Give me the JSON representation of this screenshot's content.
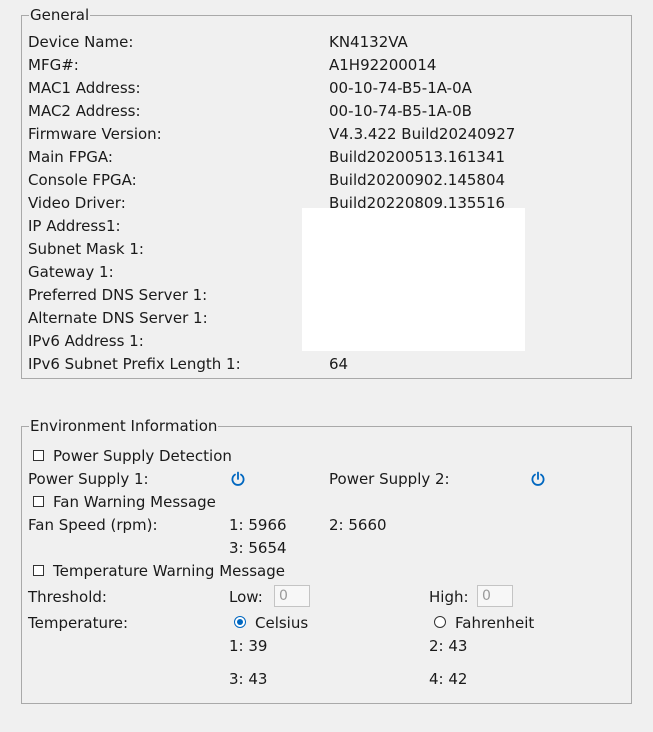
{
  "general": {
    "legend": "General",
    "rows": [
      {
        "label": "Device Name:",
        "value": "KN4132VA"
      },
      {
        "label": "MFG#:",
        "value": "A1H92200014"
      },
      {
        "label": "MAC1 Address:",
        "value": "00-10-74-B5-1A-0A"
      },
      {
        "label": "MAC2 Address:",
        "value": "00-10-74-B5-1A-0B"
      },
      {
        "label": "Firmware Version:",
        "value": "V4.3.422 Build20240927"
      },
      {
        "label": "Main FPGA:",
        "value": "Build20200513.161341"
      },
      {
        "label": "Console FPGA:",
        "value": "Build20200902.145804"
      },
      {
        "label": "Video Driver:",
        "value": "Build20220809.135516"
      },
      {
        "label": "IP Address1:",
        "value": ""
      },
      {
        "label": "Subnet Mask 1:",
        "value": ""
      },
      {
        "label": "Gateway 1:",
        "value": ""
      },
      {
        "label": "Preferred DNS Server 1:",
        "value": ""
      },
      {
        "label": "Alternate DNS Server 1:",
        "value": ""
      },
      {
        "label": "IPv6 Address 1:",
        "value": ""
      },
      {
        "label": "IPv6 Subnet Prefix Length 1:",
        "value": "64"
      }
    ]
  },
  "environment": {
    "legend": "Environment Information",
    "power_supply_detection": {
      "label": "Power Supply Detection",
      "checked": false
    },
    "power_supply_1": {
      "label": "Power Supply 1:",
      "icon": "power-icon"
    },
    "power_supply_2": {
      "label": "Power Supply 2:",
      "icon": "power-icon"
    },
    "fan_warning": {
      "label": "Fan Warning Message",
      "checked": false
    },
    "fan_speed": {
      "label": "Fan Speed (rpm):",
      "fan1": "1: 5966",
      "fan2": "2: 5660",
      "fan3": "3: 5654"
    },
    "temp_warning": {
      "label": "Temperature Warning Message",
      "checked": false
    },
    "threshold": {
      "label": "Threshold:",
      "low_label": "Low:",
      "low_value": "0",
      "high_label": "High:",
      "high_value": "0"
    },
    "temperature": {
      "label": "Temperature:",
      "celsius": "Celsius",
      "fahrenheit": "Fahrenheit",
      "selected": "Celsius",
      "t1": "1: 39",
      "t2": "2: 43",
      "t3": "3: 43",
      "t4": "4: 42"
    },
    "accent_color": "#0067c0"
  }
}
